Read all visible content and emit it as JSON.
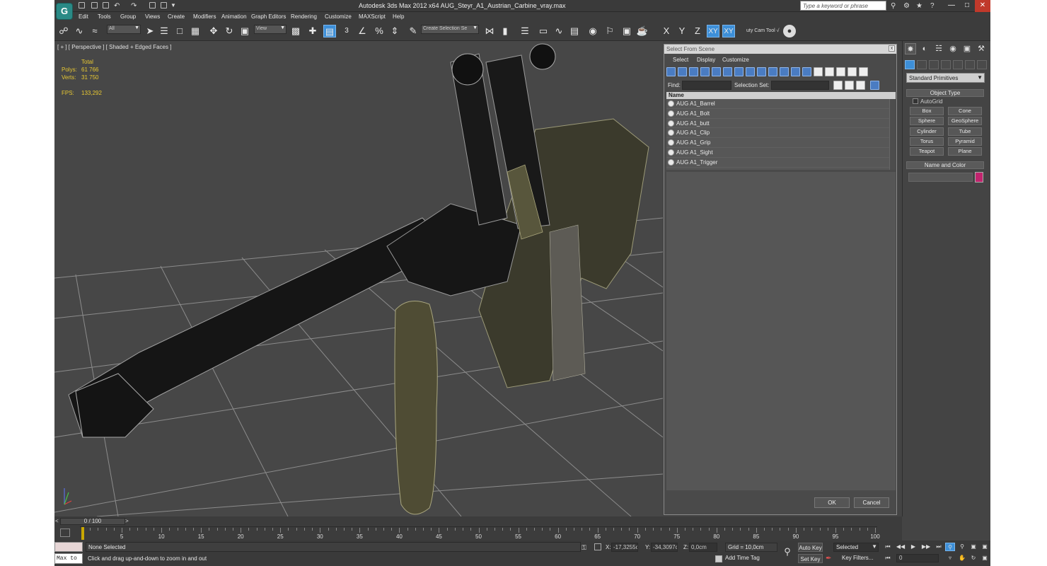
{
  "titlebar": {
    "app_title": "Autodesk 3ds Max  2012 x64     AUG_Steyr_A1_Austrian_Carbine_vray.max",
    "search_placeholder": "Type a keyword or phrase",
    "logo_glyph": "G"
  },
  "menu": [
    "Edit",
    "Tools",
    "Group",
    "Views",
    "Create",
    "Modifiers",
    "Animation",
    "Graph Editors",
    "Rendering",
    "Customize",
    "MAXScript",
    "Help"
  ],
  "toolbar": {
    "selection_filter": "All",
    "ref_coord": "View",
    "named_selection": "Create Selection Se",
    "axis_labels": [
      "X",
      "Y",
      "Z",
      "XY",
      "XY"
    ],
    "render_tool_label": "uty Cam Tool √",
    "snaps_labels": [
      "3",
      "n"
    ]
  },
  "viewport": {
    "label": "[ + ] [ Perspective ] [ Shaded + Edged Faces ]",
    "stats": {
      "total_label": "Total",
      "polys_label": "Polys:",
      "polys_value": "61 766",
      "verts_label": "Verts:",
      "verts_value": "31 750",
      "fps_label": "FPS:",
      "fps_value": "133,292"
    }
  },
  "dialog": {
    "title": "Select From Scene",
    "close_glyph": "x",
    "menu": [
      "Select",
      "Display",
      "Customize"
    ],
    "find_label": "Find:",
    "selection_set_label": "Selection Set:",
    "column_name": "Name",
    "objects": [
      "AUG A1_Barrel",
      "AUG A1_Bolt",
      "AUG A1_butt",
      "AUG A1_Clip",
      "AUG A1_Grip",
      "AUG A1_Sight",
      "AUG A1_Trigger"
    ],
    "ok_label": "OK",
    "cancel_label": "Cancel"
  },
  "command_panel": {
    "primitive_type": "Standard Primitives",
    "object_type_label": "Object Type",
    "autogrid_label": "AutoGrid",
    "buttons": [
      "Box",
      "Cone",
      "Sphere",
      "GeoSphere",
      "Cylinder",
      "Tube",
      "Torus",
      "Pyramid",
      "Teapot",
      "Plane"
    ],
    "name_color_label": "Name and Color",
    "swatch_color": "#c1246e"
  },
  "timeline": {
    "range_label": "0 / 100",
    "tick_labels": [
      "0",
      "5",
      "10",
      "15",
      "20",
      "25",
      "30",
      "35",
      "40",
      "45",
      "50",
      "55",
      "60",
      "65",
      "70",
      "75",
      "80",
      "85",
      "90",
      "95",
      "100"
    ],
    "current_frame": 0
  },
  "status": {
    "maxscript_label": "Max to",
    "selection_status": "None Selected",
    "prompt": "Click and drag up-and-down to zoom in and out",
    "x_label": "X:",
    "x_value": "-17,3255cr",
    "y_label": "Y:",
    "y_value": "-34,3097cr",
    "z_label": "Z:",
    "z_value": "0,0cm",
    "grid_label": "Grid = 10,0cm",
    "add_time_tag": "Add Time Tag",
    "auto_key": "Auto Key",
    "set_key": "Set Key",
    "key_mode": "Selected",
    "key_filters": "Key Filters...",
    "frame_value": "0"
  }
}
